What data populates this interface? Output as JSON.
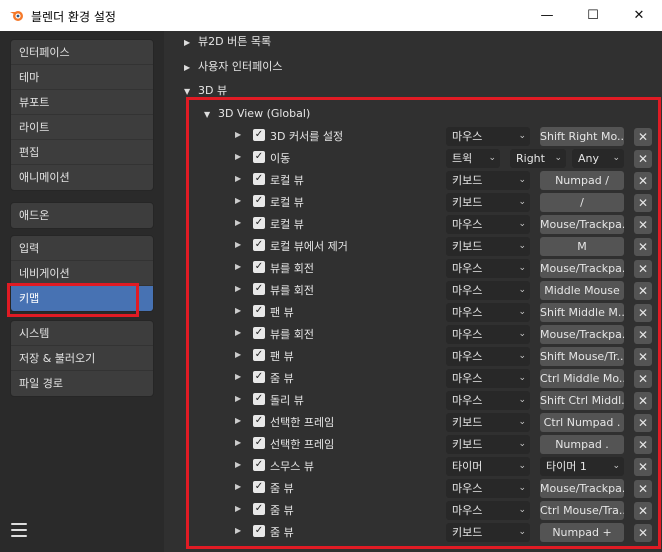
{
  "window": {
    "title": "블렌더 환경 설정",
    "min_glyph": "—",
    "max_glyph": "☐",
    "close_glyph": "✕"
  },
  "colors": {
    "highlight_box": "#e01b24",
    "active_nav": "#4772b3"
  },
  "sidebar": {
    "group1": [
      "인터페이스",
      "테마",
      "뷰포트",
      "라이트",
      "편집",
      "애니메이션"
    ],
    "group2": [
      "애드온"
    ],
    "group3": [
      "입력",
      "네비게이션",
      "키맵"
    ],
    "group4": [
      "시스템",
      "저장 & 불러오기",
      "파일 경로"
    ],
    "active": "키맵"
  },
  "sections": [
    {
      "label": "뷰2D 버튼 목록",
      "expanded": false
    },
    {
      "label": "사용자 인터페이스",
      "expanded": false
    },
    {
      "label": "3D 뷰",
      "expanded": true
    }
  ],
  "subsection": {
    "label": "3D View (Global)"
  },
  "keymap_rows": [
    {
      "name": "3D 커서를 설정",
      "type": "마우스",
      "key": "Shift Right Mo..."
    },
    {
      "name": "이동",
      "type": "트윅",
      "direction": "Right",
      "value": "Any"
    },
    {
      "name": "로컬 뷰",
      "type": "키보드",
      "key": "Numpad /"
    },
    {
      "name": "로컬 뷰",
      "type": "키보드",
      "key": "/"
    },
    {
      "name": "로컬 뷰",
      "type": "마우스",
      "key": "Mouse/Trackpa..."
    },
    {
      "name": "로컬 뷰에서 제거",
      "type": "키보드",
      "key": "M"
    },
    {
      "name": "뷰를 회전",
      "type": "마우스",
      "key": "Mouse/Trackpa..."
    },
    {
      "name": "뷰를 회전",
      "type": "마우스",
      "key": "Middle Mouse"
    },
    {
      "name": "팬 뷰",
      "type": "마우스",
      "key": "Shift Middle M..."
    },
    {
      "name": "뷰를 회전",
      "type": "마우스",
      "key": "Mouse/Trackpa..."
    },
    {
      "name": "팬 뷰",
      "type": "마우스",
      "key": "Shift Mouse/Tr..."
    },
    {
      "name": "줌 뷰",
      "type": "마우스",
      "key": "Ctrl Middle Mo..."
    },
    {
      "name": "돌리 뷰",
      "type": "마우스",
      "key": "Shift Ctrl Middl..."
    },
    {
      "name": "선택한 프레임",
      "type": "키보드",
      "key": "Ctrl Numpad ."
    },
    {
      "name": "선택한 프레임",
      "type": "키보드",
      "key": "Numpad ."
    },
    {
      "name": "스무스 뷰",
      "type": "타이머",
      "timer": "타이머 1"
    },
    {
      "name": "줌 뷰",
      "type": "마우스",
      "key": "Mouse/Trackpa..."
    },
    {
      "name": "줌 뷰",
      "type": "마우스",
      "key": "Ctrl Mouse/Tra..."
    },
    {
      "name": "줌 뷰",
      "type": "키보드",
      "key": "Numpad +"
    }
  ]
}
